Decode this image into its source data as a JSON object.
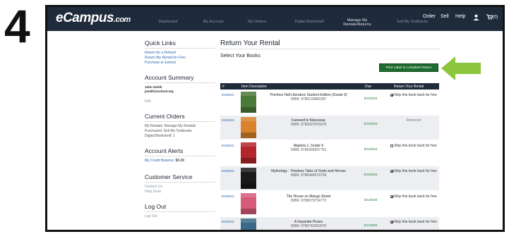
{
  "step": "4",
  "brand": {
    "logo_main": "eCampus",
    "logo_suffix": ".com"
  },
  "nav": [
    {
      "label": "Dashboard"
    },
    {
      "label": "My Account"
    },
    {
      "label": "My Orders"
    },
    {
      "label": "Digital Bookshelf"
    },
    {
      "label": "Manage My Rentals/Returns"
    },
    {
      "label": "Sell My Textbooks"
    }
  ],
  "top_right": {
    "order": "Order",
    "sell": "Sell",
    "help": "Help",
    "cart_count": "(0)"
  },
  "sidebar": {
    "quick_links": {
      "title": "Quick Links",
      "links": [
        "Return for a Refund",
        "Return My Rental for Free",
        "Purchase or Extend"
      ]
    },
    "account_summary": {
      "title": "Account Summary",
      "name": "John Smith",
      "email": "jsmith@school.org",
      "edit": "Edit"
    },
    "current_orders": {
      "title": "Current Orders",
      "lines": [
        "My Rentals: Manage My Rentals",
        "Purchased: Sell My Textbooks",
        "Digital Bookshelf: 1"
      ]
    },
    "account_alerts": {
      "title": "Account Alerts",
      "credit_label": "My Credit Balance:",
      "credit_value": "$0.00"
    },
    "customer_service": {
      "title": "Customer Service",
      "links": [
        "Contact Us",
        "Help Desk"
      ]
    },
    "log_out": {
      "title": "Log Out",
      "link": "Log Out"
    }
  },
  "main": {
    "title": "Return Your Rental",
    "subtitle": "Select Your Books",
    "print_button": "Print Label & Complete Return"
  },
  "table": {
    "headers": {
      "num": "#",
      "desc": "Item Description",
      "due": "Due",
      "ret": "Return Your Rental"
    },
    "rows": [
      {
        "num": "8199203",
        "title": "Prentice Hall Literature Student Edition (Grade 9)",
        "isbn": "ISBN: 9780133666397",
        "due": "6/1/2020",
        "ret": "Ship this book back for free",
        "status": "checked",
        "cover": "#4a7a3a"
      },
      {
        "num": "8199203",
        "title": "Farewell to Manzanar",
        "isbn": "ISBN: 9780307976079",
        "due": "6/1/2020",
        "ret": "Returned",
        "status": "returned",
        "cover": "#d9822b"
      },
      {
        "num": "8199203",
        "title": "Algebra 1, Grade 9",
        "isbn": "ISBN: 9780395937761",
        "due": "6/1/2020",
        "ret": "Ship this book back for free",
        "status": "unchecked",
        "cover": "#b3262b"
      },
      {
        "num": "8199203",
        "title": "Mythology : Timeless Tales of Gods and Heroes",
        "isbn": "ISBN: 9780446574754",
        "due": "6/1/2020",
        "ret": "Ship this book back for free",
        "status": "checked",
        "cover": "#1a1a1a"
      },
      {
        "num": "8199203",
        "title": "The House on Mango Street",
        "isbn": "ISBN: 9780679734772",
        "due": "6/1/2020",
        "ret": "Ship this book back for free",
        "status": "checked",
        "cover": "#d65a7a"
      },
      {
        "num": "8199203",
        "title": "A Separate Peace",
        "isbn": "ISBN: 9780743253970",
        "due": "6/1/2020",
        "ret": "Ship this book back for free",
        "status": "checked",
        "cover": "#3a6a88"
      }
    ]
  },
  "colors": {
    "topbar": "#1f2a3a",
    "button": "#1d6b2e",
    "arrow": "#8cc63e",
    "link": "#2c6ab5"
  }
}
